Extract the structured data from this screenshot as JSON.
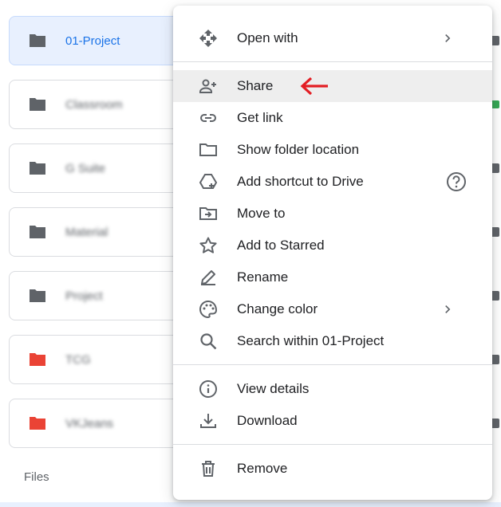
{
  "folders": [
    {
      "name": "01-Project",
      "color": "#5f6368",
      "selected": true,
      "blurred": false
    },
    {
      "name": "Classroom",
      "color": "#5f6368",
      "selected": false,
      "blurred": true
    },
    {
      "name": "G Suite",
      "color": "#5f6368",
      "selected": false,
      "blurred": true
    },
    {
      "name": "Material",
      "color": "#5f6368",
      "selected": false,
      "blurred": true
    },
    {
      "name": "Project",
      "color": "#5f6368",
      "selected": false,
      "blurred": true
    },
    {
      "name": "TCG",
      "color": "#ea4335",
      "selected": false,
      "blurred": true
    },
    {
      "name": "VKJeans",
      "color": "#ea4335",
      "selected": false,
      "blurred": true
    }
  ],
  "files_label": "Files",
  "menu": {
    "open_with": "Open with",
    "share": "Share",
    "get_link": "Get link",
    "show_folder_location": "Show folder location",
    "add_shortcut": "Add shortcut to Drive",
    "move_to": "Move to",
    "add_starred": "Add to Starred",
    "rename": "Rename",
    "change_color": "Change color",
    "search_within": "Search within 01-Project",
    "view_details": "View details",
    "download": "Download",
    "remove": "Remove"
  },
  "colors": {
    "icon": "#5f6368",
    "highlight": "#eeeeee",
    "arrow": "#e31e24",
    "selected_bg": "#e8f0fe",
    "selected_text": "#1a73e8"
  },
  "icons": {
    "open_with": "move-arrows-icon",
    "share": "person-add-icon",
    "get_link": "link-icon",
    "show_folder_location": "folder-outline-icon",
    "add_shortcut": "drive-shortcut-icon",
    "move_to": "folder-move-icon",
    "add_starred": "star-outline-icon",
    "rename": "pencil-icon",
    "change_color": "palette-icon",
    "search_within": "search-icon",
    "view_details": "info-icon",
    "download": "download-icon",
    "remove": "trash-icon"
  }
}
